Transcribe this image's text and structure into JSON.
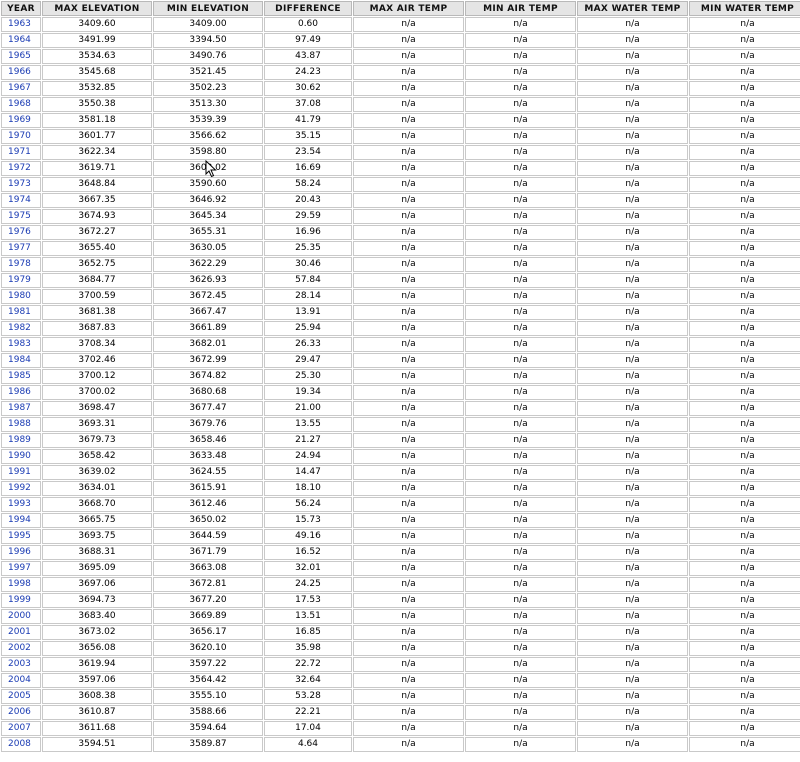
{
  "table": {
    "headers": [
      "YEAR",
      "MAX ELEVATION",
      "MIN ELEVATION",
      "DIFFERENCE",
      "MAX AIR TEMP",
      "MIN AIR TEMP",
      "MAX WATER TEMP",
      "MIN WATER TEMP"
    ],
    "rows": [
      [
        "1963",
        "3409.60",
        "3409.00",
        "0.60",
        "n/a",
        "n/a",
        "n/a",
        "n/a"
      ],
      [
        "1964",
        "3491.99",
        "3394.50",
        "97.49",
        "n/a",
        "n/a",
        "n/a",
        "n/a"
      ],
      [
        "1965",
        "3534.63",
        "3490.76",
        "43.87",
        "n/a",
        "n/a",
        "n/a",
        "n/a"
      ],
      [
        "1966",
        "3545.68",
        "3521.45",
        "24.23",
        "n/a",
        "n/a",
        "n/a",
        "n/a"
      ],
      [
        "1967",
        "3532.85",
        "3502.23",
        "30.62",
        "n/a",
        "n/a",
        "n/a",
        "n/a"
      ],
      [
        "1968",
        "3550.38",
        "3513.30",
        "37.08",
        "n/a",
        "n/a",
        "n/a",
        "n/a"
      ],
      [
        "1969",
        "3581.18",
        "3539.39",
        "41.79",
        "n/a",
        "n/a",
        "n/a",
        "n/a"
      ],
      [
        "1970",
        "3601.77",
        "3566.62",
        "35.15",
        "n/a",
        "n/a",
        "n/a",
        "n/a"
      ],
      [
        "1971",
        "3622.34",
        "3598.80",
        "23.54",
        "n/a",
        "n/a",
        "n/a",
        "n/a"
      ],
      [
        "1972",
        "3619.71",
        "3603.02",
        "16.69",
        "n/a",
        "n/a",
        "n/a",
        "n/a"
      ],
      [
        "1973",
        "3648.84",
        "3590.60",
        "58.24",
        "n/a",
        "n/a",
        "n/a",
        "n/a"
      ],
      [
        "1974",
        "3667.35",
        "3646.92",
        "20.43",
        "n/a",
        "n/a",
        "n/a",
        "n/a"
      ],
      [
        "1975",
        "3674.93",
        "3645.34",
        "29.59",
        "n/a",
        "n/a",
        "n/a",
        "n/a"
      ],
      [
        "1976",
        "3672.27",
        "3655.31",
        "16.96",
        "n/a",
        "n/a",
        "n/a",
        "n/a"
      ],
      [
        "1977",
        "3655.40",
        "3630.05",
        "25.35",
        "n/a",
        "n/a",
        "n/a",
        "n/a"
      ],
      [
        "1978",
        "3652.75",
        "3622.29",
        "30.46",
        "n/a",
        "n/a",
        "n/a",
        "n/a"
      ],
      [
        "1979",
        "3684.77",
        "3626.93",
        "57.84",
        "n/a",
        "n/a",
        "n/a",
        "n/a"
      ],
      [
        "1980",
        "3700.59",
        "3672.45",
        "28.14",
        "n/a",
        "n/a",
        "n/a",
        "n/a"
      ],
      [
        "1981",
        "3681.38",
        "3667.47",
        "13.91",
        "n/a",
        "n/a",
        "n/a",
        "n/a"
      ],
      [
        "1982",
        "3687.83",
        "3661.89",
        "25.94",
        "n/a",
        "n/a",
        "n/a",
        "n/a"
      ],
      [
        "1983",
        "3708.34",
        "3682.01",
        "26.33",
        "n/a",
        "n/a",
        "n/a",
        "n/a"
      ],
      [
        "1984",
        "3702.46",
        "3672.99",
        "29.47",
        "n/a",
        "n/a",
        "n/a",
        "n/a"
      ],
      [
        "1985",
        "3700.12",
        "3674.82",
        "25.30",
        "n/a",
        "n/a",
        "n/a",
        "n/a"
      ],
      [
        "1986",
        "3700.02",
        "3680.68",
        "19.34",
        "n/a",
        "n/a",
        "n/a",
        "n/a"
      ],
      [
        "1987",
        "3698.47",
        "3677.47",
        "21.00",
        "n/a",
        "n/a",
        "n/a",
        "n/a"
      ],
      [
        "1988",
        "3693.31",
        "3679.76",
        "13.55",
        "n/a",
        "n/a",
        "n/a",
        "n/a"
      ],
      [
        "1989",
        "3679.73",
        "3658.46",
        "21.27",
        "n/a",
        "n/a",
        "n/a",
        "n/a"
      ],
      [
        "1990",
        "3658.42",
        "3633.48",
        "24.94",
        "n/a",
        "n/a",
        "n/a",
        "n/a"
      ],
      [
        "1991",
        "3639.02",
        "3624.55",
        "14.47",
        "n/a",
        "n/a",
        "n/a",
        "n/a"
      ],
      [
        "1992",
        "3634.01",
        "3615.91",
        "18.10",
        "n/a",
        "n/a",
        "n/a",
        "n/a"
      ],
      [
        "1993",
        "3668.70",
        "3612.46",
        "56.24",
        "n/a",
        "n/a",
        "n/a",
        "n/a"
      ],
      [
        "1994",
        "3665.75",
        "3650.02",
        "15.73",
        "n/a",
        "n/a",
        "n/a",
        "n/a"
      ],
      [
        "1995",
        "3693.75",
        "3644.59",
        "49.16",
        "n/a",
        "n/a",
        "n/a",
        "n/a"
      ],
      [
        "1996",
        "3688.31",
        "3671.79",
        "16.52",
        "n/a",
        "n/a",
        "n/a",
        "n/a"
      ],
      [
        "1997",
        "3695.09",
        "3663.08",
        "32.01",
        "n/a",
        "n/a",
        "n/a",
        "n/a"
      ],
      [
        "1998",
        "3697.06",
        "3672.81",
        "24.25",
        "n/a",
        "n/a",
        "n/a",
        "n/a"
      ],
      [
        "1999",
        "3694.73",
        "3677.20",
        "17.53",
        "n/a",
        "n/a",
        "n/a",
        "n/a"
      ],
      [
        "2000",
        "3683.40",
        "3669.89",
        "13.51",
        "n/a",
        "n/a",
        "n/a",
        "n/a"
      ],
      [
        "2001",
        "3673.02",
        "3656.17",
        "16.85",
        "n/a",
        "n/a",
        "n/a",
        "n/a"
      ],
      [
        "2002",
        "3656.08",
        "3620.10",
        "35.98",
        "n/a",
        "n/a",
        "n/a",
        "n/a"
      ],
      [
        "2003",
        "3619.94",
        "3597.22",
        "22.72",
        "n/a",
        "n/a",
        "n/a",
        "n/a"
      ],
      [
        "2004",
        "3597.06",
        "3564.42",
        "32.64",
        "n/a",
        "n/a",
        "n/a",
        "n/a"
      ],
      [
        "2005",
        "3608.38",
        "3555.10",
        "53.28",
        "n/a",
        "n/a",
        "n/a",
        "n/a"
      ],
      [
        "2006",
        "3610.87",
        "3588.66",
        "22.21",
        "n/a",
        "n/a",
        "n/a",
        "n/a"
      ],
      [
        "2007",
        "3611.68",
        "3594.64",
        "17.04",
        "n/a",
        "n/a",
        "n/a",
        "n/a"
      ],
      [
        "2008",
        "3594.51",
        "3589.87",
        "4.64",
        "n/a",
        "n/a",
        "n/a",
        "n/a"
      ]
    ]
  },
  "colors": {
    "link": "#1a3bb3",
    "header_bg": "#e5e5e5",
    "cell_border": "#c9c9c9"
  },
  "cursor": {
    "icon": "mouse-pointer-icon"
  }
}
